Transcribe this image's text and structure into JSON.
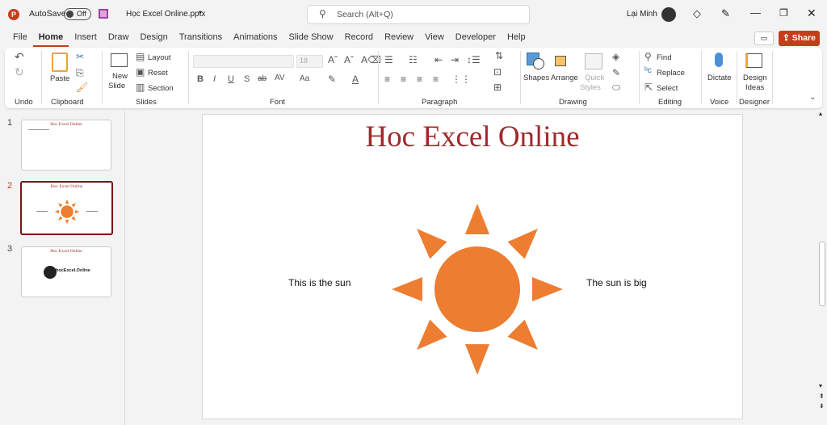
{
  "titlebar": {
    "autosave_label": "AutoSave",
    "autosave_state": "Off",
    "filename": "Học Excel Online.pptx",
    "search_placeholder": "Search (Alt+Q)",
    "user": "Lại Minh"
  },
  "tabs": [
    "File",
    "Home",
    "Insert",
    "Draw",
    "Design",
    "Transitions",
    "Animations",
    "Slide Show",
    "Record",
    "Review",
    "View",
    "Developer",
    "Help"
  ],
  "active_tab": "Home",
  "share_label": "Share",
  "ribbon": {
    "groups": {
      "undo": "Undo",
      "clipboard": "Clipboard",
      "slides": "Slides",
      "font": "Font",
      "paragraph": "Paragraph",
      "drawing": "Drawing",
      "editing": "Editing",
      "voice": "Voice",
      "designer": "Designer"
    },
    "paste": "Paste",
    "new_slide_1": "New",
    "new_slide_2": "Slide",
    "layout": "Layout",
    "reset": "Reset",
    "section": "Section",
    "font_size": "18",
    "shapes": "Shapes",
    "arrange": "Arrange",
    "quick_styles_1": "Quick",
    "quick_styles_2": "Styles",
    "find": "Find",
    "replace": "Replace",
    "select": "Select",
    "dictate": "Dictate",
    "design_ideas_1": "Design",
    "design_ideas_2": "Ideas"
  },
  "thumbnails": [
    {
      "num": "1",
      "title": "Hoc Excel Online"
    },
    {
      "num": "2",
      "title": "Hoc Excel Online"
    },
    {
      "num": "3",
      "title": "Hoc Excel Online",
      "logo": "hocExcel.Online"
    }
  ],
  "selected_slide": 2,
  "slide": {
    "title": "Hoc Excel Online",
    "left_text": "This is the sun",
    "right_text": "The sun is big",
    "title_color": "#9e2a2b",
    "sun_color": "#ed7d31"
  }
}
